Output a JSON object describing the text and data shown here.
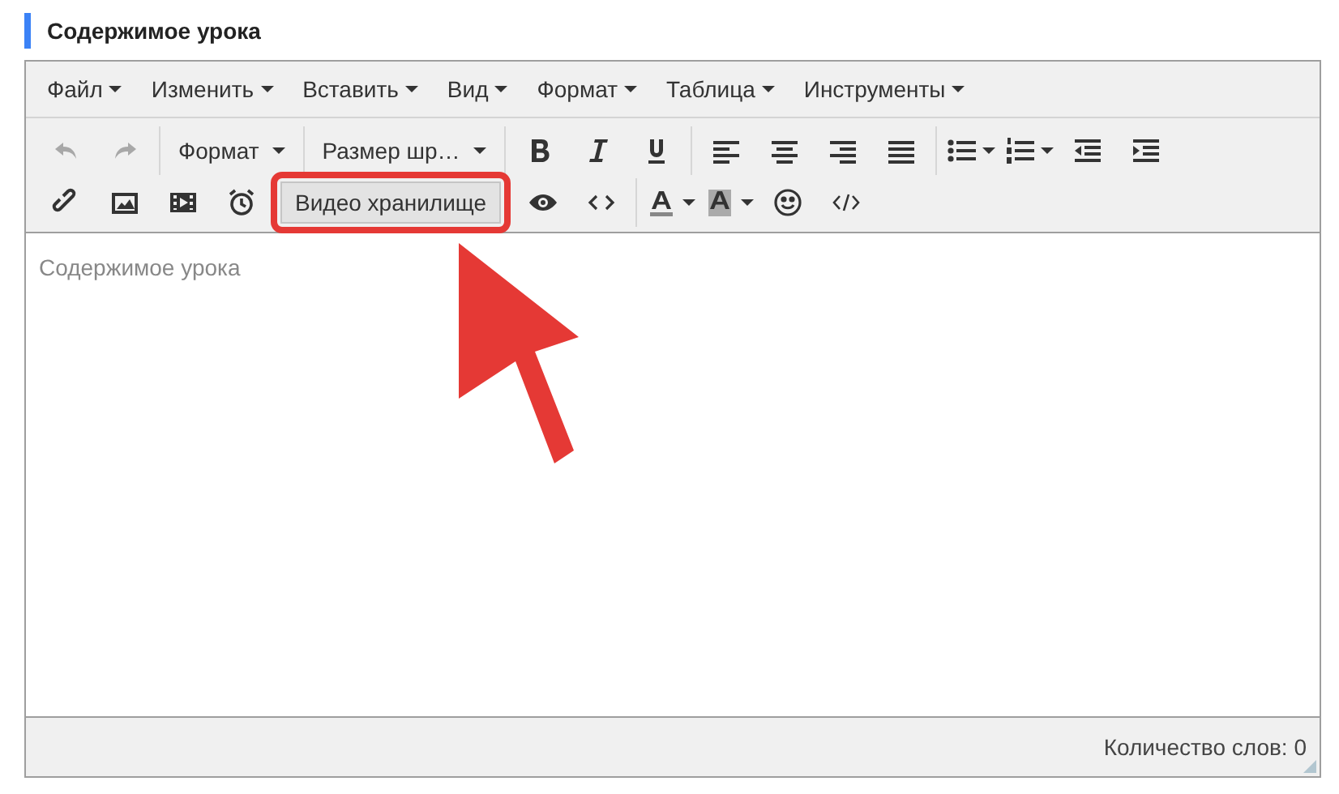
{
  "section_title": "Содержимое урока",
  "menubar": [
    {
      "label": "Файл"
    },
    {
      "label": "Изменить"
    },
    {
      "label": "Вставить"
    },
    {
      "label": "Вид"
    },
    {
      "label": "Формат"
    },
    {
      "label": "Таблица"
    },
    {
      "label": "Инструменты"
    }
  ],
  "toolbar_rows": [
    [
      [
        {
          "kind": "undo",
          "disabled": true
        },
        {
          "kind": "redo",
          "disabled": true
        }
      ],
      [
        {
          "kind": "select",
          "label": "Формат"
        }
      ],
      [
        {
          "kind": "select",
          "label": "Размер шр…"
        }
      ],
      [
        {
          "kind": "bold"
        },
        {
          "kind": "italic"
        },
        {
          "kind": "underline"
        }
      ],
      [
        {
          "kind": "alignleft"
        },
        {
          "kind": "aligncenter"
        },
        {
          "kind": "alignright"
        },
        {
          "kind": "justify"
        }
      ],
      [
        {
          "kind": "bullist"
        },
        {
          "kind": "numlist"
        },
        {
          "kind": "outdent"
        },
        {
          "kind": "indent"
        }
      ]
    ],
    [
      [
        {
          "kind": "link"
        },
        {
          "kind": "image"
        },
        {
          "kind": "media"
        },
        {
          "kind": "alarm"
        },
        {
          "kind": "text",
          "label": "Видео хранилище",
          "highlighted": true
        },
        {
          "kind": "preview"
        },
        {
          "kind": "codesample"
        }
      ],
      [
        {
          "kind": "forecolor"
        },
        {
          "kind": "backcolor"
        },
        {
          "kind": "emoticon"
        },
        {
          "kind": "code"
        }
      ]
    ]
  ],
  "editor": {
    "placeholder": "Содержимое урока"
  },
  "status_bar": {
    "word_count": "Количество слов: 0"
  }
}
